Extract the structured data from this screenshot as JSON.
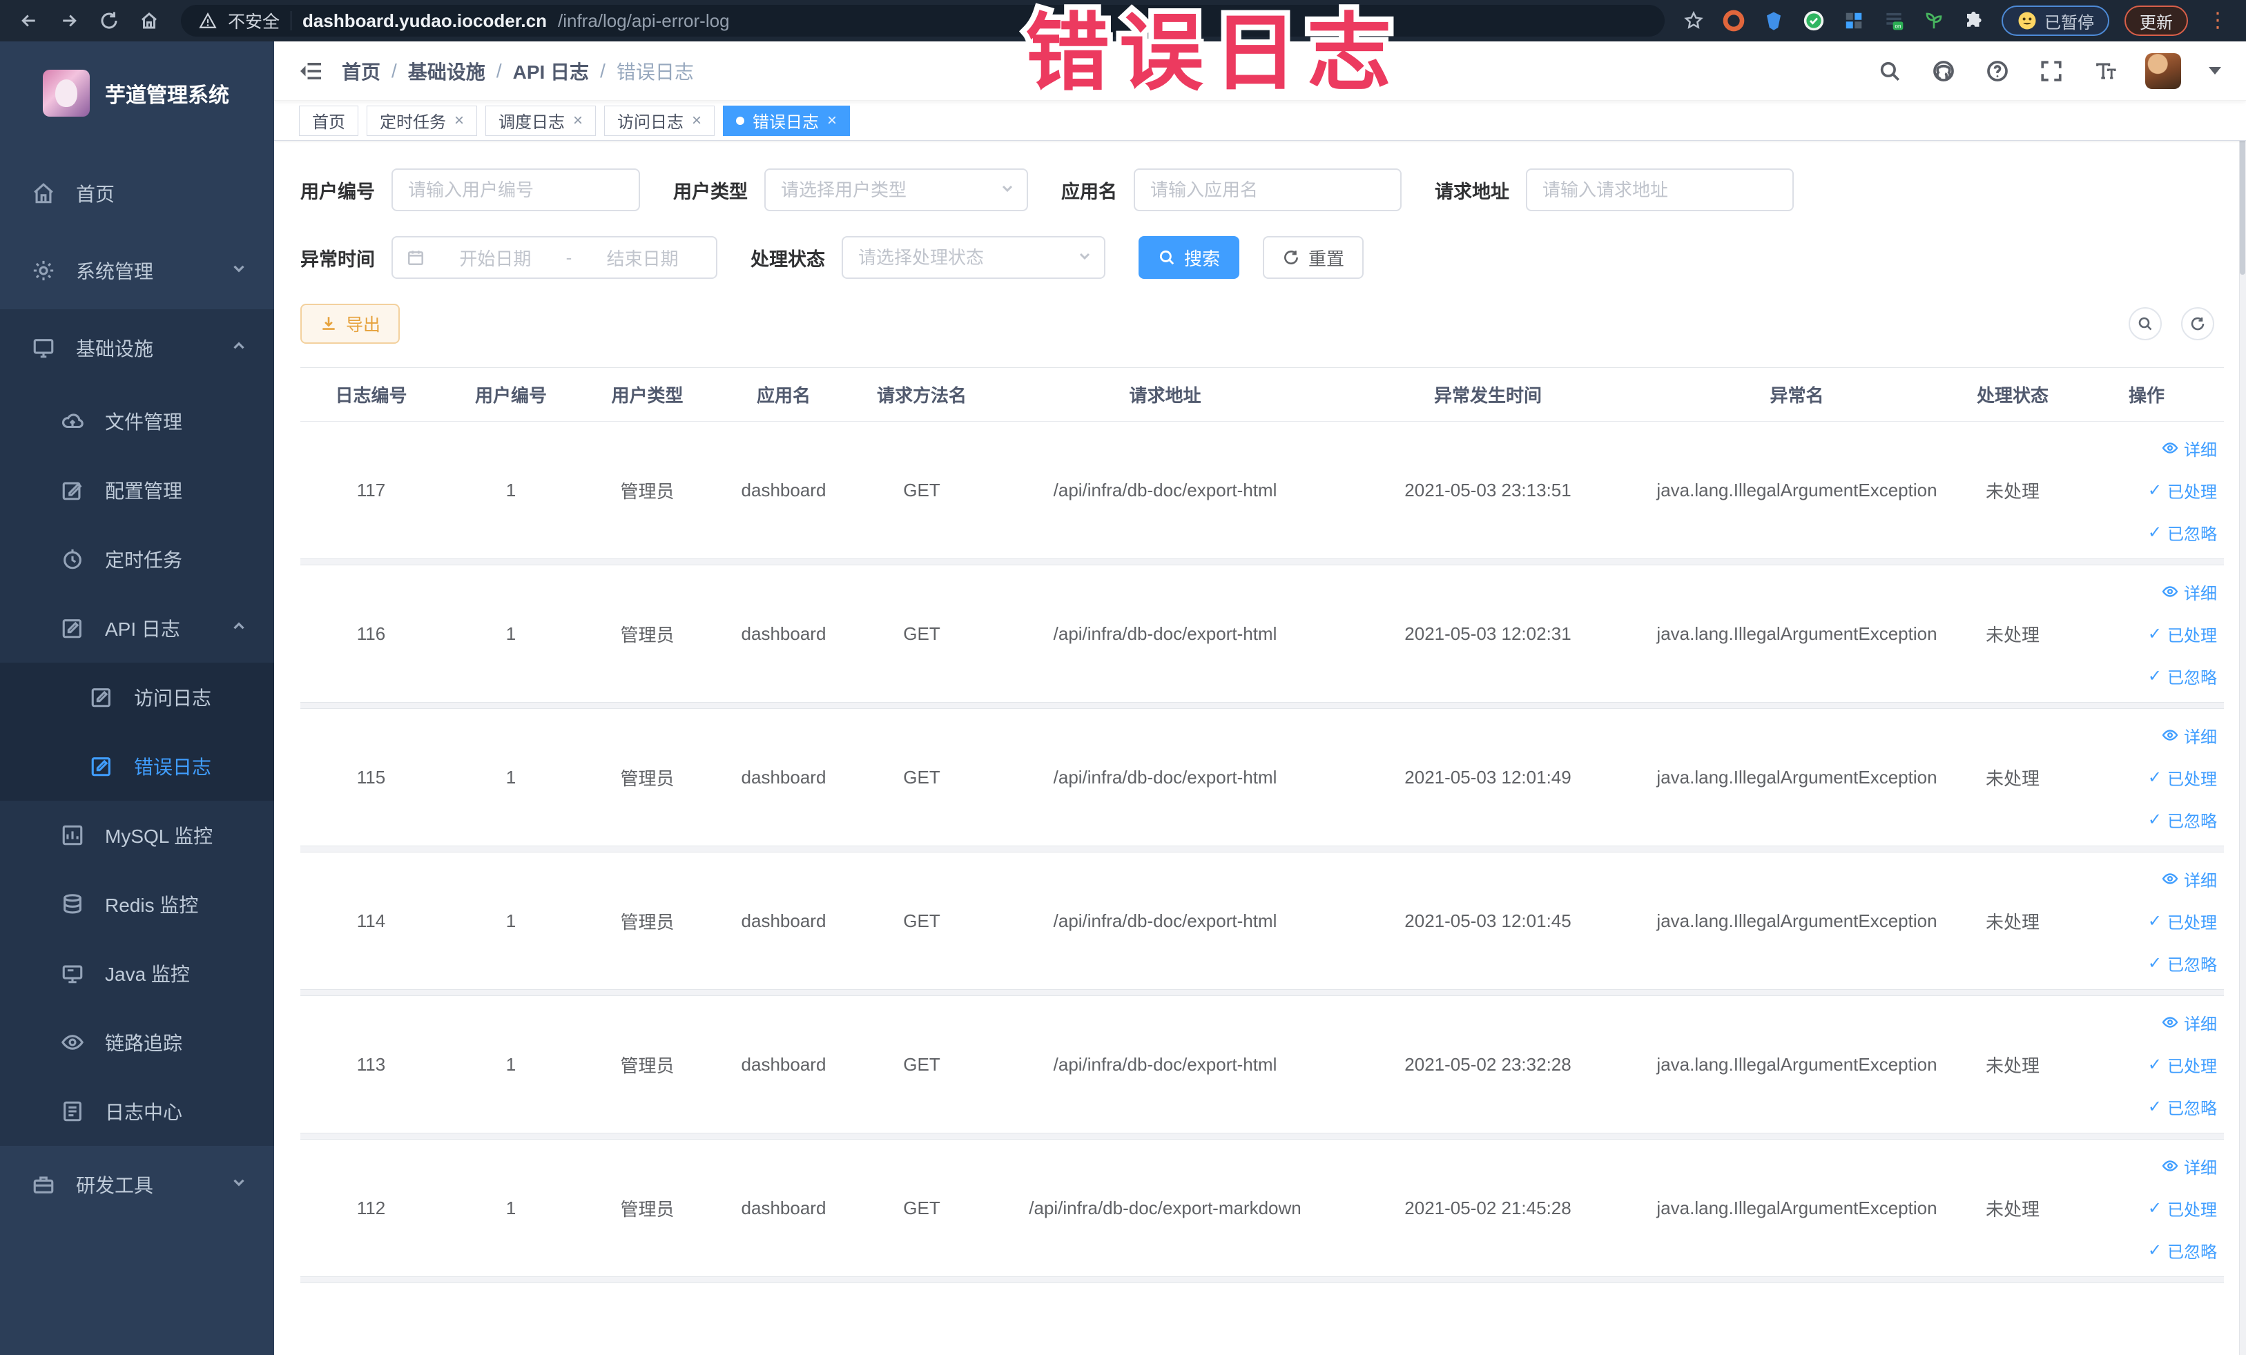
{
  "colors": {
    "accent": "#409eff",
    "warning": "#e6a23c",
    "overlay_red": "#ec3a5f",
    "sidebar_bg": "#2c3e58",
    "sidebar_sub_bg": "#24344b",
    "sidebar_subsub_bg": "#1d2b3f",
    "browser_bar_bg": "#1d2836"
  },
  "overlay_title": "错误日志",
  "browser": {
    "security_label": "不安全",
    "url_host": "dashboard.yudao.iocoder.cn",
    "url_path": "/infra/log/api-error-log",
    "paused_badge": "已暂停",
    "update_button": "更新",
    "menu_glyph": "⋮"
  },
  "sidebar": {
    "logo_title": "芋道管理系统",
    "menu": [
      {
        "label": "首页"
      },
      {
        "label": "系统管理"
      },
      {
        "label": "基础设施",
        "children": [
          {
            "label": "文件管理"
          },
          {
            "label": "配置管理"
          },
          {
            "label": "定时任务"
          },
          {
            "label": "API 日志",
            "children": [
              {
                "label": "访问日志"
              },
              {
                "label": "错误日志",
                "active": true
              }
            ]
          },
          {
            "label": "MySQL 监控"
          },
          {
            "label": "Redis 监控"
          },
          {
            "label": "Java 监控"
          },
          {
            "label": "链路追踪"
          },
          {
            "label": "日志中心"
          }
        ]
      },
      {
        "label": "研发工具"
      }
    ]
  },
  "header": {
    "breadcrumbs": [
      "首页",
      "基础设施",
      "API 日志",
      "错误日志"
    ],
    "breadcrumb_separator": "/"
  },
  "tabsbar": {
    "close_glyph": "×",
    "tabs": [
      {
        "label": "首页",
        "closable": false,
        "active": false
      },
      {
        "label": "定时任务",
        "closable": true,
        "active": false
      },
      {
        "label": "调度日志",
        "closable": true,
        "active": false
      },
      {
        "label": "访问日志",
        "closable": true,
        "active": false
      },
      {
        "label": "错误日志",
        "closable": true,
        "active": true
      }
    ]
  },
  "filters": {
    "user_id": {
      "label": "用户编号",
      "placeholder": "请输入用户编号",
      "value": ""
    },
    "user_type": {
      "label": "用户类型",
      "placeholder": "请选择用户类型",
      "value": ""
    },
    "app_name": {
      "label": "应用名",
      "placeholder": "请输入应用名",
      "value": ""
    },
    "request_url": {
      "label": "请求地址",
      "placeholder": "请输入请求地址",
      "value": ""
    },
    "exception_time": {
      "label": "异常时间",
      "start_placeholder": "开始日期",
      "separator": "-",
      "end_placeholder": "结束日期"
    },
    "process_status": {
      "label": "处理状态",
      "placeholder": "请选择处理状态",
      "value": ""
    },
    "search_label": "搜索",
    "reset_label": "重置"
  },
  "toolbar": {
    "export_label": "导出"
  },
  "table": {
    "columns": [
      "日志编号",
      "用户编号",
      "用户类型",
      "应用名",
      "请求方法名",
      "请求地址",
      "异常发生时间",
      "异常名",
      "处理状态",
      "操作"
    ],
    "check_glyph": "✓",
    "actions": [
      {
        "name": "detail",
        "label": "详细"
      },
      {
        "name": "processed",
        "label": "已处理"
      },
      {
        "name": "ignored",
        "label": "已忽略"
      }
    ],
    "rows": [
      {
        "id": "117",
        "user_id": "1",
        "user_type": "管理员",
        "app": "dashboard",
        "method": "GET",
        "url": "/api/infra/db-doc/export-html",
        "time": "2021-05-03 23:13:51",
        "exception": "java.lang.IllegalArgumentException",
        "status": "未处理"
      },
      {
        "id": "116",
        "user_id": "1",
        "user_type": "管理员",
        "app": "dashboard",
        "method": "GET",
        "url": "/api/infra/db-doc/export-html",
        "time": "2021-05-03 12:02:31",
        "exception": "java.lang.IllegalArgumentException",
        "status": "未处理"
      },
      {
        "id": "115",
        "user_id": "1",
        "user_type": "管理员",
        "app": "dashboard",
        "method": "GET",
        "url": "/api/infra/db-doc/export-html",
        "time": "2021-05-03 12:01:49",
        "exception": "java.lang.IllegalArgumentException",
        "status": "未处理"
      },
      {
        "id": "114",
        "user_id": "1",
        "user_type": "管理员",
        "app": "dashboard",
        "method": "GET",
        "url": "/api/infra/db-doc/export-html",
        "time": "2021-05-03 12:01:45",
        "exception": "java.lang.IllegalArgumentException",
        "status": "未处理"
      },
      {
        "id": "113",
        "user_id": "1",
        "user_type": "管理员",
        "app": "dashboard",
        "method": "GET",
        "url": "/api/infra/db-doc/export-html",
        "time": "2021-05-02 23:32:28",
        "exception": "java.lang.IllegalArgumentException",
        "status": "未处理"
      },
      {
        "id": "112",
        "user_id": "1",
        "user_type": "管理员",
        "app": "dashboard",
        "method": "GET",
        "url": "/api/infra/db-doc/export-markdown",
        "time": "2021-05-02 21:45:28",
        "exception": "java.lang.IllegalArgumentException",
        "status": "未处理"
      }
    ]
  }
}
